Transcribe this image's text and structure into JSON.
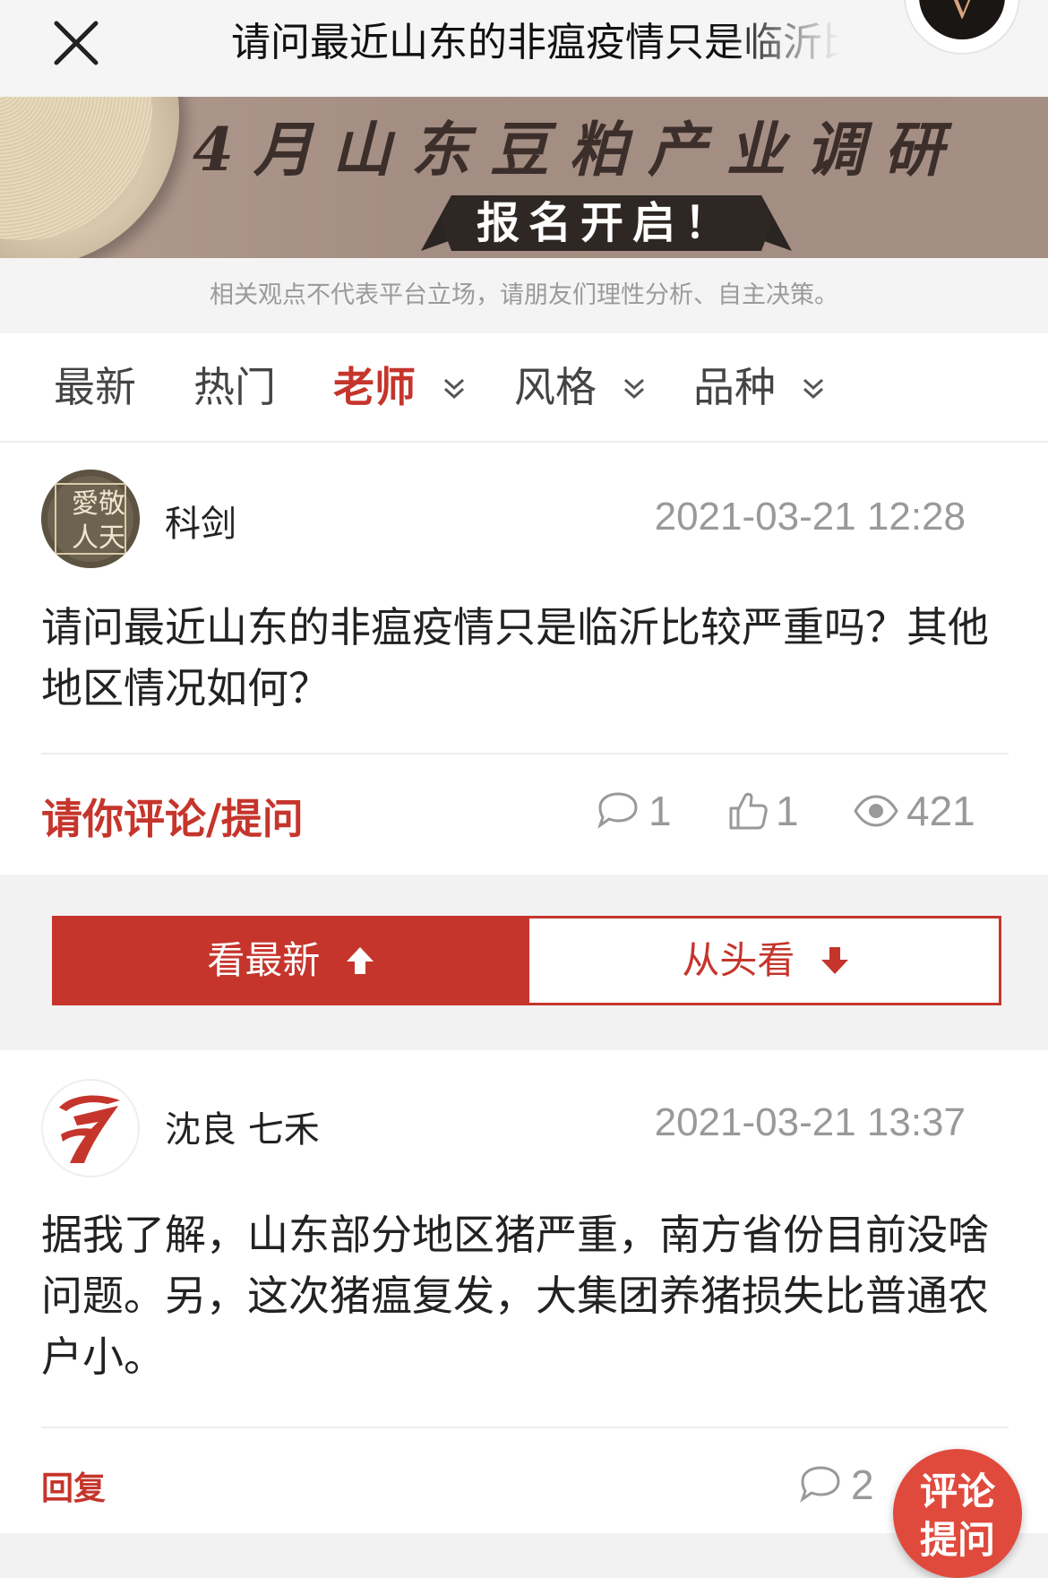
{
  "header": {
    "title": "请问最近山东的非瘟疫情只是临沂比较严重吗？其他地区情况如何？",
    "vip_badge": "V"
  },
  "banner": {
    "title": "4月山东豆粕产业调研",
    "cta": "报名开启！"
  },
  "disclaimer": "相关观点不代表平台立场，请朋友们理性分析、自主决策。",
  "tabs": [
    {
      "label": "最新"
    },
    {
      "label": "热门"
    },
    {
      "label": "老师"
    },
    {
      "label": "风格"
    },
    {
      "label": "品种"
    }
  ],
  "post": {
    "author": "科剑",
    "avatar_text": "愛敬人天",
    "time": "2021-03-21 12:28",
    "content": "请问最近山东的非瘟疫情只是临沂比较严重吗？其他地区情况如何？",
    "comment_prompt": "请你评论/提问",
    "comments": "1",
    "likes": "1",
    "views": "421"
  },
  "sort": {
    "newest": "看最新",
    "from_start": "从头看"
  },
  "reply": {
    "author": "沈良 七禾",
    "time": "2021-03-21 13:37",
    "content": "据我了解，山东部分地区猪严重，南方省份目前没啥问题。另，这次猪瘟复发，大集团养猪损失比普通农户小。",
    "reply_label": "回复",
    "comments": "2"
  },
  "float_button": {
    "line1": "评论",
    "line2": "提问"
  },
  "colors": {
    "accent": "#c5352c",
    "muted": "#999999"
  }
}
